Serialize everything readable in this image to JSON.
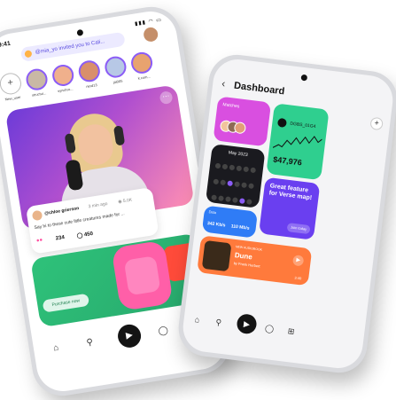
{
  "left_phone": {
    "time": "9:41",
    "status_icons": "▮▮▮ ◠ ▭",
    "invite_text": "@mia_yo invited you to Cali...",
    "stories": [
      {
        "label": "New_user"
      },
      {
        "label": "structur..."
      },
      {
        "label": "synchro..."
      },
      {
        "label": "nerd13"
      },
      {
        "label": "jai005"
      },
      {
        "label": "k.com..."
      }
    ],
    "post": {
      "more": "⋯",
      "author": "@chloe grierson",
      "ago": "3 min ago",
      "views": "◉ 5.0K",
      "text": "Say hi to these cute little creatures made for ...",
      "reactions": "●●",
      "likes": "234",
      "comments": "◯ 450"
    },
    "promo_button": "Purchase now",
    "nav": {
      "home": "⌂",
      "pin": "⚲",
      "play": "▶",
      "chat": "◯",
      "grid": "⊞"
    }
  },
  "right_phone": {
    "back": "‹",
    "title": "Dashboard",
    "plus": "+",
    "matches_label": "Matches",
    "stock_head": "DGBS_01G4",
    "stock_price": "$47,976",
    "calendar_title": "May 2023",
    "feature_text": "Great feature for Verse map!",
    "feature_button": "Join today",
    "data_label": "Data",
    "data_up": "342 Kb/s",
    "data_down": "110 Mb/s",
    "dune": {
      "tag": "NEW AUDIOBOOK",
      "title": "Dune",
      "by": "by Frank Herbert",
      "length": "3:40",
      "play": "▶"
    },
    "nav": {
      "home": "⌂",
      "pin": "⚲",
      "play": "▶",
      "chat": "◯",
      "grid": "⊞"
    }
  },
  "colors": {
    "accent": "#8b5cf6",
    "matches": "#d94fe0",
    "stock": "#2fcf8f",
    "feature": "#6a3ff0",
    "data": "#2f7cf6",
    "dune": "#ff7a3c"
  }
}
